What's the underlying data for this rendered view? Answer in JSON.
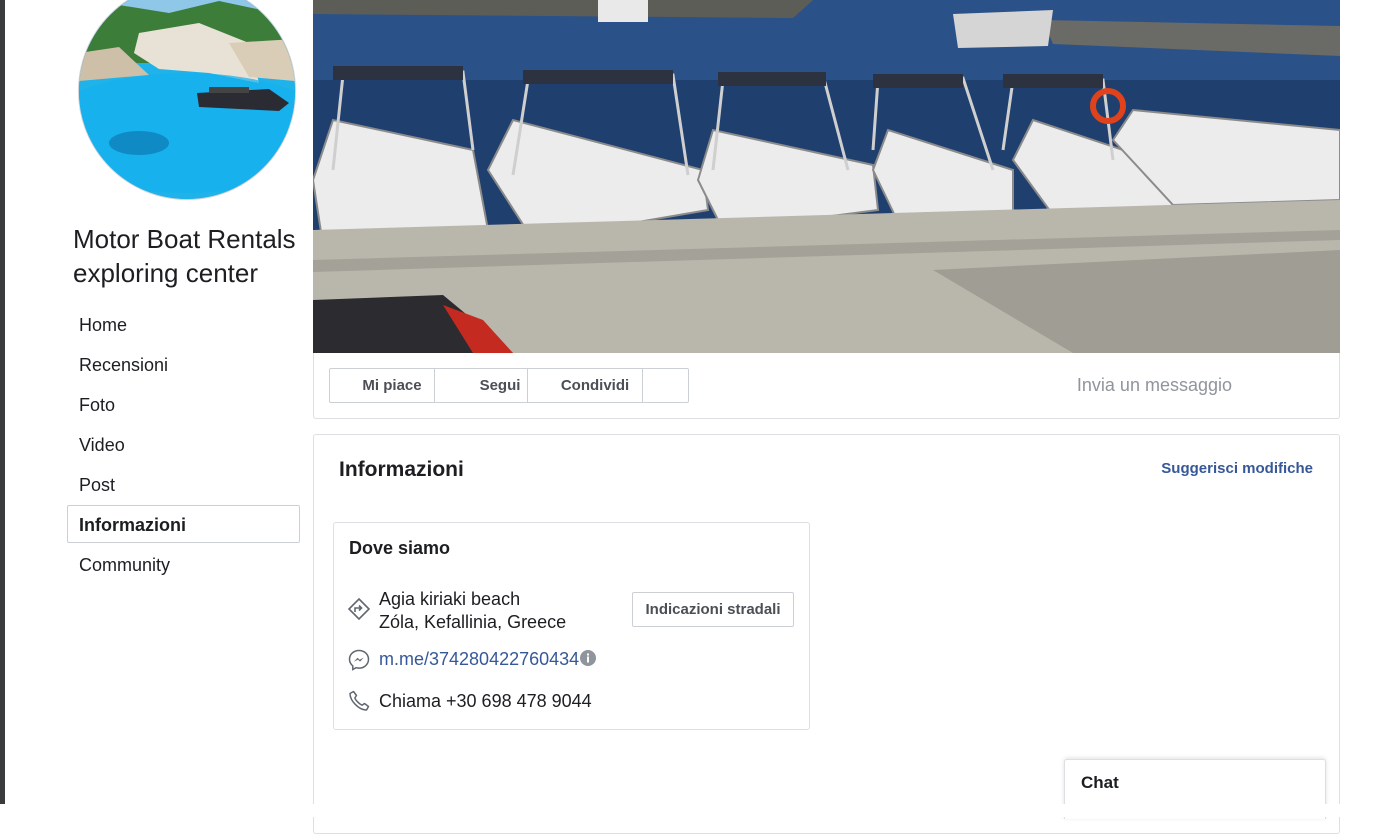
{
  "page": {
    "name": "Motor Boat Rentals exploring center"
  },
  "nav": {
    "items": [
      {
        "label": "Home",
        "active": false
      },
      {
        "label": "Recensioni",
        "active": false
      },
      {
        "label": "Foto",
        "active": false
      },
      {
        "label": "Video",
        "active": false
      },
      {
        "label": "Post",
        "active": false
      },
      {
        "label": "Informazioni",
        "active": true
      },
      {
        "label": "Community",
        "active": false
      }
    ]
  },
  "actions": {
    "like": "Mi piace",
    "follow": "Segui",
    "share": "Condividi",
    "send_message": "Invia un messaggio"
  },
  "info": {
    "title": "Informazioni",
    "suggest_edits": "Suggerisci modifiche",
    "where": {
      "title": "Dove siamo",
      "address_line1": "Agia kiriaki beach",
      "address_line2": "Zóla, Kefallinia, Greece",
      "directions_button": "Indicazioni stradali",
      "messenger_link": "m.me/374280422760434",
      "phone": "Chiama +30 698 478 9044"
    }
  },
  "chat": {
    "label": "Chat"
  },
  "icons": {
    "directions": "directions-icon",
    "messenger": "messenger-icon",
    "info": "info-icon",
    "phone": "phone-icon"
  },
  "colors": {
    "link": "#365899",
    "muted": "#90949c",
    "border": "#dddfe2"
  }
}
